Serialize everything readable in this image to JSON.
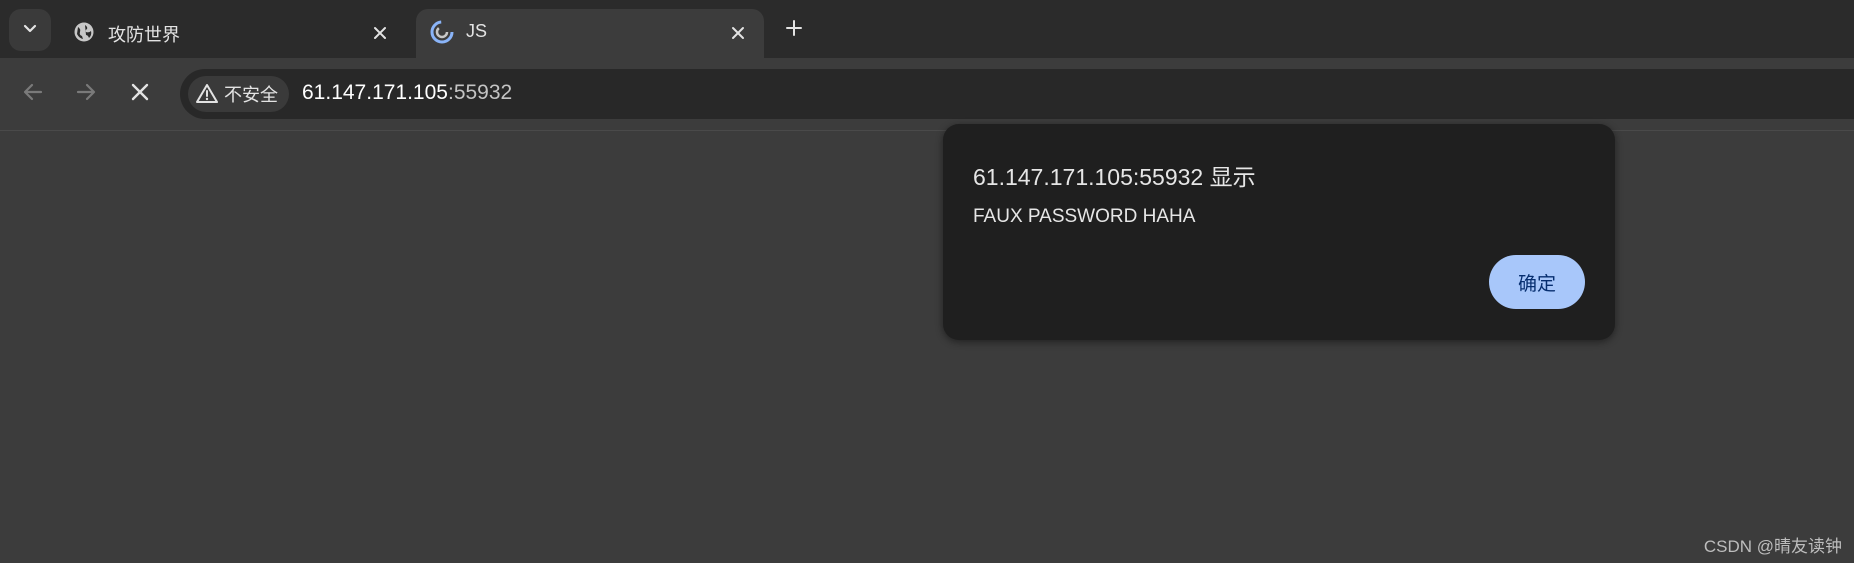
{
  "tabs": [
    {
      "title": "攻防世界",
      "favicon": "globe-icon",
      "active": false
    },
    {
      "title": "JS",
      "favicon": "loading-favicon-icon",
      "active": true
    }
  ],
  "toolbar": {
    "security_chip_label": "不安全",
    "url_host": "61.147.171.105",
    "url_port": ":55932"
  },
  "dialog": {
    "title": "61.147.171.105:55932 显示",
    "message": "FAUX PASSWORD HAHA",
    "ok_label": "确定"
  },
  "watermark": "CSDN @晴友读钟",
  "colors": {
    "tabbar_bg": "#2b2b2b",
    "page_bg": "#3c3c3c",
    "dialog_bg": "#1f1f1f",
    "ok_button_bg": "#a8c7fa",
    "ok_button_text": "#062e6f"
  }
}
